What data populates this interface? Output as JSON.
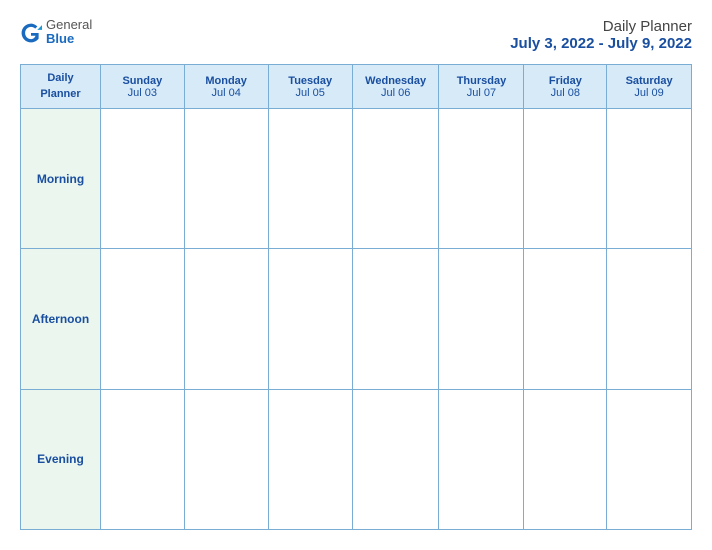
{
  "header": {
    "logo": {
      "general": "General",
      "blue": "Blue"
    },
    "title": "Daily Planner",
    "date_range": "July 3, 2022 - July 9, 2022"
  },
  "table": {
    "corner_label_line1": "Daily",
    "corner_label_line2": "Planner",
    "days": [
      {
        "name": "Sunday",
        "date": "Jul 03"
      },
      {
        "name": "Monday",
        "date": "Jul 04"
      },
      {
        "name": "Tuesday",
        "date": "Jul 05"
      },
      {
        "name": "Wednesday",
        "date": "Jul 06"
      },
      {
        "name": "Thursday",
        "date": "Jul 07"
      },
      {
        "name": "Friday",
        "date": "Jul 08"
      },
      {
        "name": "Saturday",
        "date": "Jul 09"
      }
    ],
    "rows": [
      {
        "label": "Morning"
      },
      {
        "label": "Afternoon"
      },
      {
        "label": "Evening"
      }
    ]
  }
}
